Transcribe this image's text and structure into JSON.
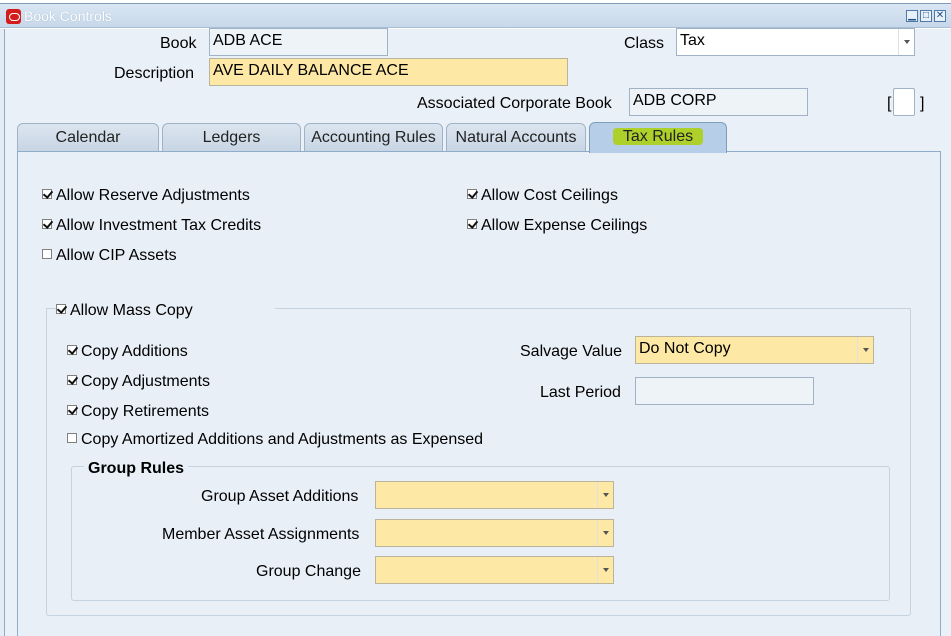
{
  "window": {
    "title": "Book Controls",
    "minimize_icon": "minimize-icon",
    "maximize_icon": "maximize-icon",
    "close_icon": "close-icon"
  },
  "header": {
    "book_label": "Book",
    "book_value": "ADB ACE",
    "class_label": "Class",
    "class_value": "Tax",
    "description_label": "Description",
    "description_value": "AVE DAILY BALANCE ACE",
    "assoc_label": "Associated Corporate Book",
    "assoc_value": "ADB CORP",
    "flex_open": "[",
    "flex_close": "]"
  },
  "tabs": [
    {
      "label": "Calendar"
    },
    {
      "label": "Ledgers"
    },
    {
      "label": "Accounting Rules"
    },
    {
      "label": "Natural Accounts"
    },
    {
      "label": "Tax Rules",
      "active": true
    }
  ],
  "tax_rules": {
    "options": [
      {
        "label": "Allow Reserve Adjustments",
        "checked": true
      },
      {
        "label": "Allow Investment Tax Credits",
        "checked": true
      },
      {
        "label": "Allow CIP Assets",
        "checked": false
      },
      {
        "label": "Allow Cost Ceilings",
        "checked": true
      },
      {
        "label": "Allow Expense Ceilings",
        "checked": true
      }
    ],
    "mass_copy": {
      "label": "Allow Mass Copy",
      "checked": true,
      "options": [
        {
          "label": "Copy Additions",
          "checked": true
        },
        {
          "label": "Copy Adjustments",
          "checked": true
        },
        {
          "label": "Copy Retirements",
          "checked": true
        },
        {
          "label": "Copy Amortized Additions and Adjustments as Expensed",
          "checked": false
        }
      ],
      "salvage_value_label": "Salvage Value",
      "salvage_value": "Do Not Copy",
      "last_period_label": "Last Period",
      "last_period_value": ""
    },
    "group_rules": {
      "title": "Group Rules",
      "group_asset_additions_label": "Group Asset Additions",
      "group_asset_additions_value": "",
      "member_asset_assignments_label": "Member Asset Assignments",
      "member_asset_assignments_value": "",
      "group_change_label": "Group Change",
      "group_change_value": ""
    }
  },
  "colors": {
    "required_field": "#fde9a5",
    "active_tab": "#b6cee8",
    "tab_highlight": "#aed02a"
  }
}
